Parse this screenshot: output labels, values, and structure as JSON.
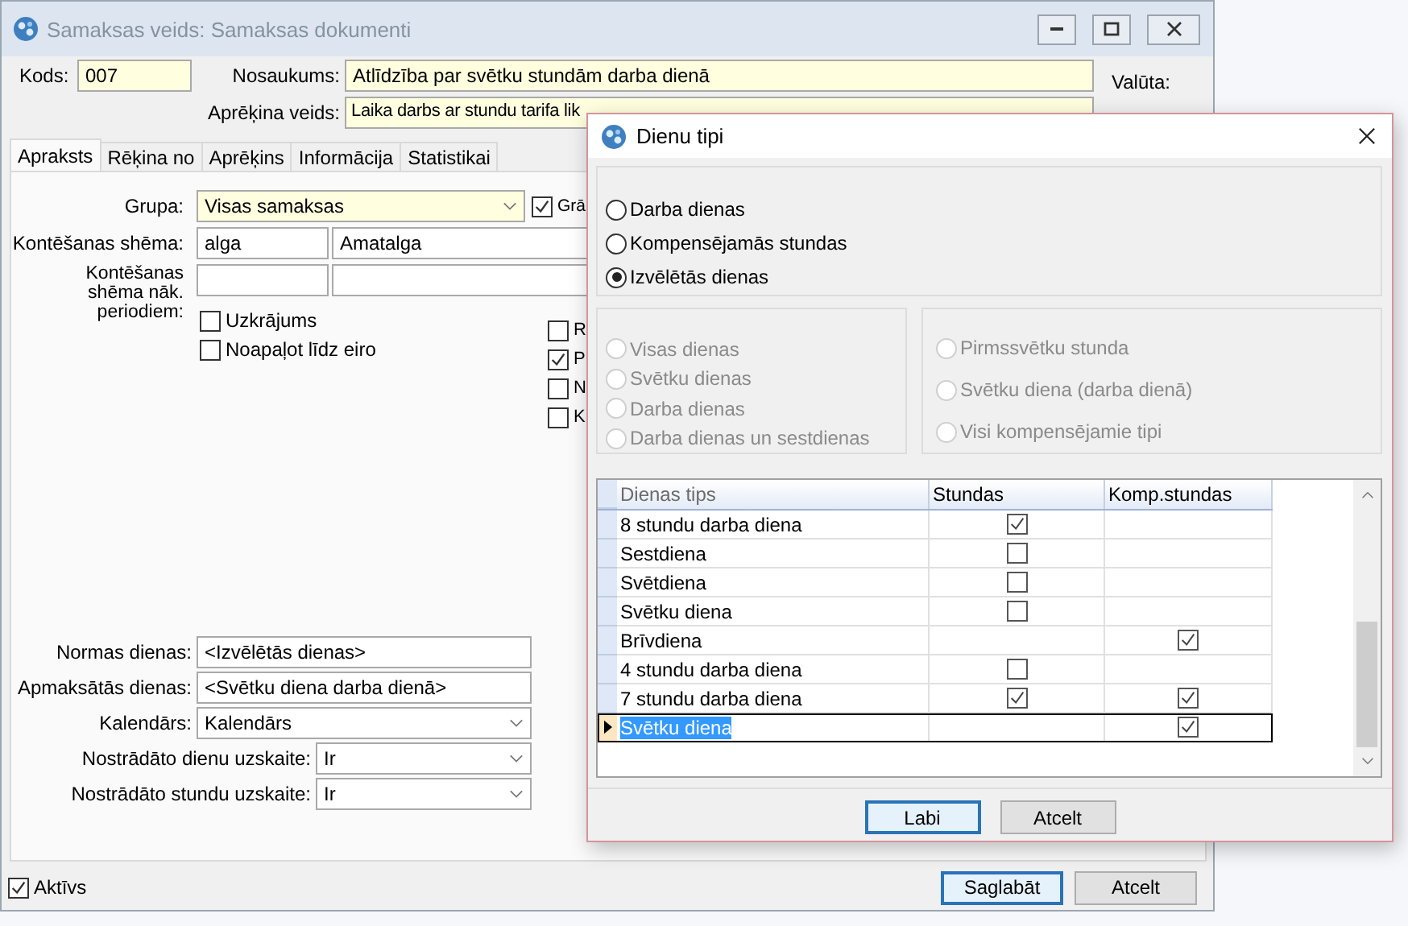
{
  "window": {
    "title": "Samaksas veids: Samaksas dokumenti"
  },
  "kods": {
    "label": "Kods:",
    "value": "007"
  },
  "nosaukums": {
    "label": "Nosaukums:",
    "value": "Atlīdzība par svētku stundām darba dienā"
  },
  "aprekina_veids": {
    "label": "Aprēķina veids:",
    "value": "Laika darbs ar stundu tarifa lik"
  },
  "valuta": {
    "label": "Valūta:"
  },
  "tabs": [
    {
      "label": "Apraksts",
      "selected": true
    },
    {
      "label": "Rēķina no",
      "selected": false
    },
    {
      "label": "Aprēķins",
      "selected": false
    },
    {
      "label": "Informācija",
      "selected": false
    },
    {
      "label": "Statistikai",
      "selected": false
    }
  ],
  "grupa": {
    "label": "Grupa:",
    "value": "Visas samaksas",
    "check": {
      "label": "Grā",
      "checked": true
    }
  },
  "kontesanas_shema": {
    "label": "Kontēšanas shēma:",
    "code": "alga",
    "name": "Amatalga"
  },
  "kontesanas_next": {
    "label": "Kontēšanas shēma nāk. periodiem:"
  },
  "options_left": [
    {
      "label": "Uzkrājums",
      "checked": false
    },
    {
      "label": "Noapaļot līdz eiro",
      "checked": false
    }
  ],
  "options_right": [
    {
      "label": "R",
      "checked": false
    },
    {
      "label": "P",
      "checked": true
    },
    {
      "label": "N",
      "checked": false
    },
    {
      "label": "K",
      "checked": false
    }
  ],
  "day_fields": [
    {
      "label": "Normas dienas:",
      "value": "<Izvēlētās dienas>",
      "kind": "text"
    },
    {
      "label": "Apmaksātās dienas:",
      "value": "<Svētku diena darba dienā>",
      "kind": "text"
    },
    {
      "label": "Kalendārs:",
      "value": "Kalendārs",
      "kind": "combo"
    }
  ],
  "uzskaite": [
    {
      "label": "Nostrādāto dienu uzskaite:",
      "value": "Ir"
    },
    {
      "label": "Nostrādāto stundu uzskaite:",
      "value": "Ir"
    }
  ],
  "active": {
    "label": "Aktīvs",
    "checked": true
  },
  "buttons": [
    {
      "label": "Saglabāt",
      "default": true
    },
    {
      "label": "Atcelt",
      "default": false
    }
  ],
  "dialog": {
    "title": "Dienu tipi",
    "mode_options": [
      {
        "label": "Darba dienas",
        "selected": false
      },
      {
        "label": "Kompensējamās stundas",
        "selected": false
      },
      {
        "label": "Izvēlētās dienas",
        "selected": true
      }
    ],
    "day_options": [
      {
        "label": "Visas dienas",
        "selected": false,
        "disabled": true
      },
      {
        "label": "Svētku dienas",
        "selected": false,
        "disabled": true
      },
      {
        "label": "Darba dienas",
        "selected": false,
        "disabled": true
      },
      {
        "label": "Darba dienas un sestdienas",
        "selected": false,
        "disabled": true
      }
    ],
    "comp_options": [
      {
        "label": "Pirmssvētku stunda",
        "selected": false,
        "disabled": true
      },
      {
        "label": "Svētku diena (darba dienā)",
        "selected": false,
        "disabled": true
      },
      {
        "label": "Visi kompensējamie tipi",
        "selected": false,
        "disabled": true
      }
    ],
    "grid": {
      "columns": [
        "Dienas tips",
        "Stundas",
        "Komp.stundas"
      ],
      "rows": [
        {
          "name": "8 stundu darba diena",
          "stundas": true,
          "komp": null,
          "selected": false
        },
        {
          "name": "Sestdiena",
          "stundas": false,
          "komp": null,
          "selected": false
        },
        {
          "name": "Svētdiena",
          "stundas": false,
          "komp": null,
          "selected": false
        },
        {
          "name": "Svētku diena",
          "stundas": false,
          "komp": null,
          "selected": false
        },
        {
          "name": "Brīvdiena",
          "stundas": null,
          "komp": true,
          "selected": false
        },
        {
          "name": "4 stundu darba diena",
          "stundas": false,
          "komp": null,
          "selected": false
        },
        {
          "name": "7 stundu darba diena",
          "stundas": true,
          "komp": true,
          "selected": false
        },
        {
          "name": "Svētku diena",
          "stundas": null,
          "komp": true,
          "selected": true
        }
      ]
    },
    "buttons": [
      {
        "label": "Labi",
        "default": true
      },
      {
        "label": "Atcelt",
        "default": false
      }
    ]
  }
}
